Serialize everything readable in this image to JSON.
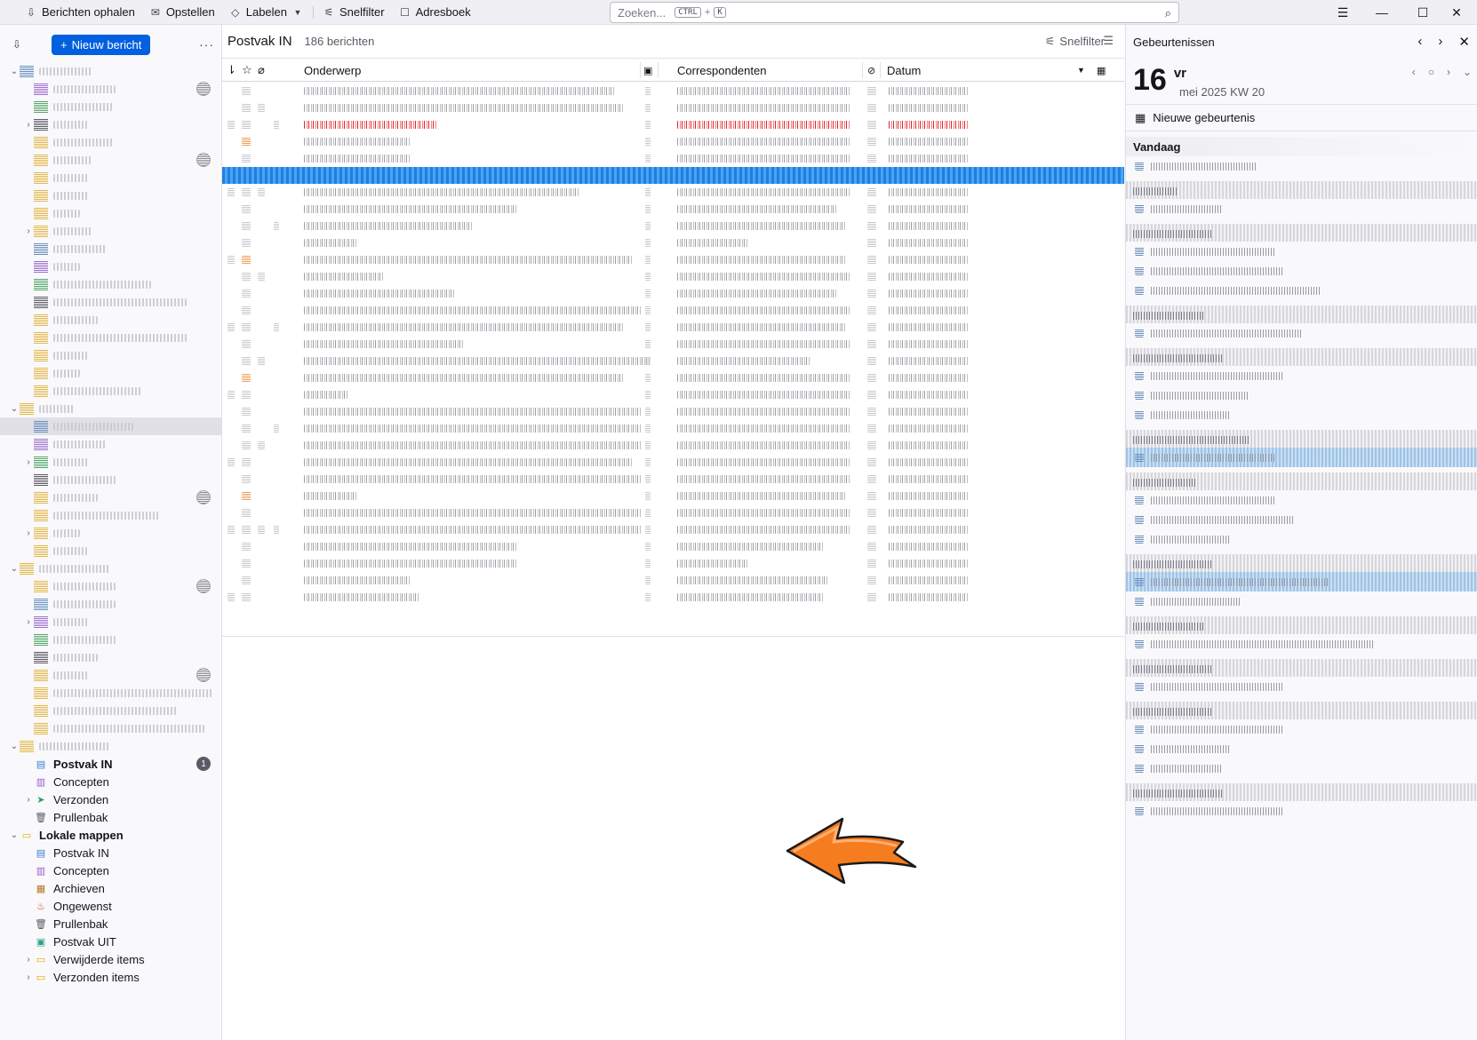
{
  "toolbar": {
    "get_messages": "Berichten ophalen",
    "compose": "Opstellen",
    "tag": "Labelen",
    "quick_filter": "Snelfilter",
    "address_book": "Adresboek",
    "search_placeholder": "Zoeken...",
    "kbd_ctrl": "CTRL",
    "kbd_plus": "+",
    "kbd_k": "K"
  },
  "folder_pane": {
    "new_message": "Nieuw bericht",
    "more": "···",
    "visible_folders": [
      {
        "label": "Postvak IN",
        "bold": true,
        "badge": "1",
        "icon": "inbox-icon"
      },
      {
        "label": "Concepten",
        "icon": "drafts-icon"
      },
      {
        "label": "Verzonden",
        "icon": "sent-icon",
        "twisty": true
      },
      {
        "label": "Prullenbak",
        "icon": "trash-icon"
      },
      {
        "label": "Lokale mappen",
        "bold": true,
        "icon": "folder-icon",
        "twisty_open": true,
        "account": true
      },
      {
        "label": "Postvak IN",
        "icon": "inbox-icon"
      },
      {
        "label": "Concepten",
        "icon": "drafts-icon"
      },
      {
        "label": "Archieven",
        "icon": "archive-icon"
      },
      {
        "label": "Ongewenst",
        "icon": "junk-icon"
      },
      {
        "label": "Prullenbak",
        "icon": "trash-icon"
      },
      {
        "label": "Postvak UIT",
        "icon": "outbox-icon"
      },
      {
        "label": "Verwijderde items",
        "icon": "folder-icon",
        "twisty": true
      },
      {
        "label": "Verzonden items",
        "icon": "folder-icon",
        "twisty": true
      }
    ]
  },
  "message_list": {
    "title": "Postvak IN",
    "count": "186 berichten",
    "quick_filter": "Snelfilter",
    "columns": {
      "subject": "Onderwerp",
      "correspondents": "Correspondenten",
      "date": "Datum"
    }
  },
  "calendar": {
    "title": "Gebeurtenissen",
    "day": "16",
    "weekday": "vr",
    "month_week": "mei 2025  KW 20",
    "new_event": "Nieuwe gebeurtenis",
    "today": "Vandaag"
  },
  "colors": {
    "accent": "#0060df",
    "selection": "#2b8ee8",
    "arrow": "#f57c1f"
  }
}
